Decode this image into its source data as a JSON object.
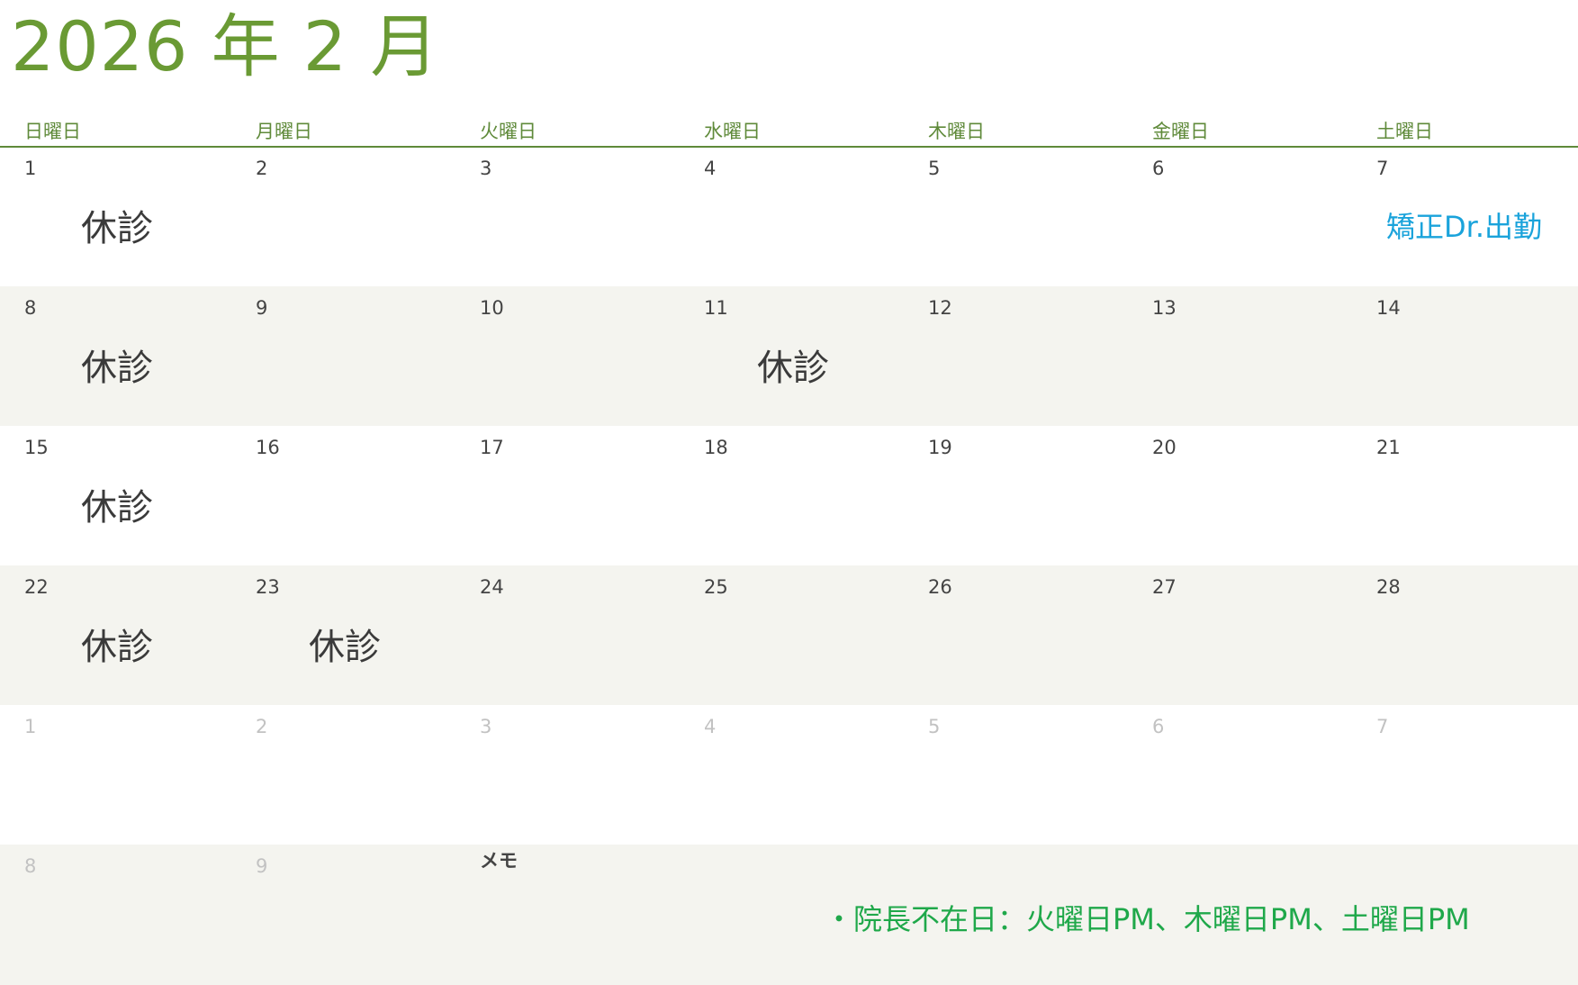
{
  "title": "2026 年 2 月",
  "weekdays": [
    "日曜日",
    "月曜日",
    "火曜日",
    "水曜日",
    "木曜日",
    "金曜日",
    "土曜日"
  ],
  "weeks": [
    {
      "days": [
        {
          "num": "1",
          "note": "休診"
        },
        {
          "num": "2",
          "note": ""
        },
        {
          "num": "3",
          "note": ""
        },
        {
          "num": "4",
          "note": ""
        },
        {
          "num": "5",
          "note": ""
        },
        {
          "num": "6",
          "note": ""
        },
        {
          "num": "7",
          "note": "矯正Dr.出勤"
        }
      ]
    },
    {
      "days": [
        {
          "num": "8",
          "note": "休診"
        },
        {
          "num": "9",
          "note": ""
        },
        {
          "num": "10",
          "note": ""
        },
        {
          "num": "11",
          "note": "休診"
        },
        {
          "num": "12",
          "note": ""
        },
        {
          "num": "13",
          "note": ""
        },
        {
          "num": "14",
          "note": ""
        }
      ]
    },
    {
      "days": [
        {
          "num": "15",
          "note": "休診"
        },
        {
          "num": "16",
          "note": ""
        },
        {
          "num": "17",
          "note": ""
        },
        {
          "num": "18",
          "note": ""
        },
        {
          "num": "19",
          "note": ""
        },
        {
          "num": "20",
          "note": ""
        },
        {
          "num": "21",
          "note": ""
        }
      ]
    },
    {
      "days": [
        {
          "num": "22",
          "note": "休診"
        },
        {
          "num": "23",
          "note": "休診"
        },
        {
          "num": "24",
          "note": ""
        },
        {
          "num": "25",
          "note": ""
        },
        {
          "num": "26",
          "note": ""
        },
        {
          "num": "27",
          "note": ""
        },
        {
          "num": "28",
          "note": ""
        }
      ]
    },
    {
      "days": [
        {
          "num": "1",
          "note": ""
        },
        {
          "num": "2",
          "note": ""
        },
        {
          "num": "3",
          "note": ""
        },
        {
          "num": "4",
          "note": ""
        },
        {
          "num": "5",
          "note": ""
        },
        {
          "num": "6",
          "note": ""
        },
        {
          "num": "7",
          "note": ""
        }
      ]
    },
    {
      "days": [
        {
          "num": "8",
          "note": ""
        },
        {
          "num": "9",
          "note": ""
        }
      ]
    }
  ],
  "memo": {
    "label": "メモ",
    "text": "・院長不在日：火曜日PM、木曜日PM、土曜日PM"
  },
  "colors": {
    "title": "#6a9a34",
    "header_line": "#5f8a3a",
    "shaded_row": "#f4f4ef",
    "orthodontist_note": "#1aa3db",
    "memo_text": "#1fa84a"
  }
}
